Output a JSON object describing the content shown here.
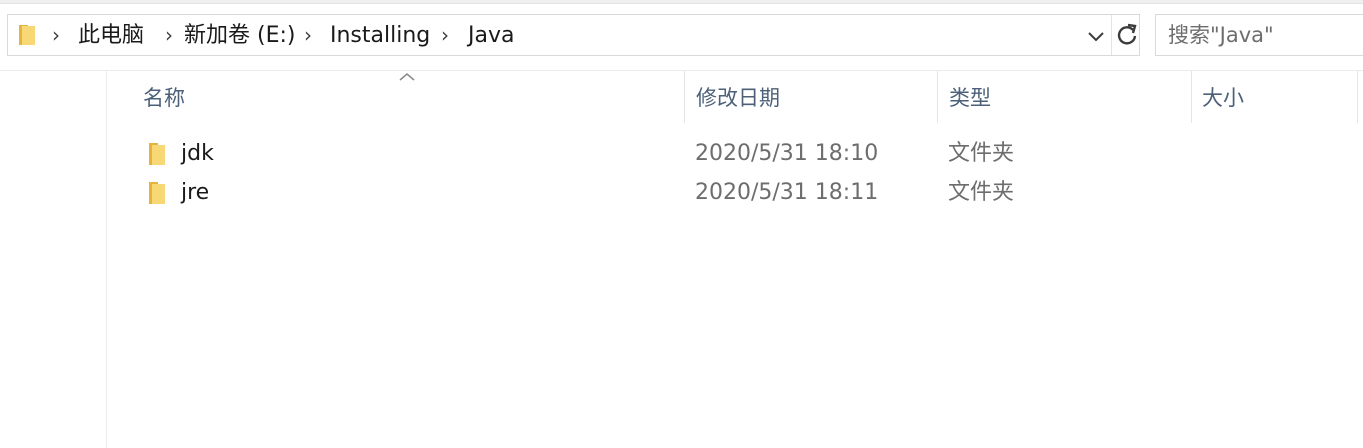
{
  "address_bar": {
    "icon": "folder-icon",
    "breadcrumbs": [
      "此电脑",
      "新加卷 (E:)",
      "Installing",
      "Java"
    ],
    "dropdown_icon": "chevron-down-icon",
    "refresh_icon": "refresh-icon"
  },
  "search": {
    "placeholder": "搜索\"Java\"",
    "value": ""
  },
  "columns": {
    "name": "名称",
    "date_modified": "修改日期",
    "type": "类型",
    "size": "大小",
    "sort_indicator": "sort-ascending-icon"
  },
  "files": [
    {
      "name": "jdk",
      "date_modified": "2020/5/31 18:10",
      "type": "文件夹",
      "size": "",
      "icon": "folder-icon"
    },
    {
      "name": "jre",
      "date_modified": "2020/5/31 18:11",
      "type": "文件夹",
      "size": "",
      "icon": "folder-icon"
    }
  ],
  "colors": {
    "folder_yellow": "#f8d775",
    "folder_yellow_dark": "#e6b33e",
    "header_text": "#4c607a",
    "border": "#d9d9d9"
  }
}
